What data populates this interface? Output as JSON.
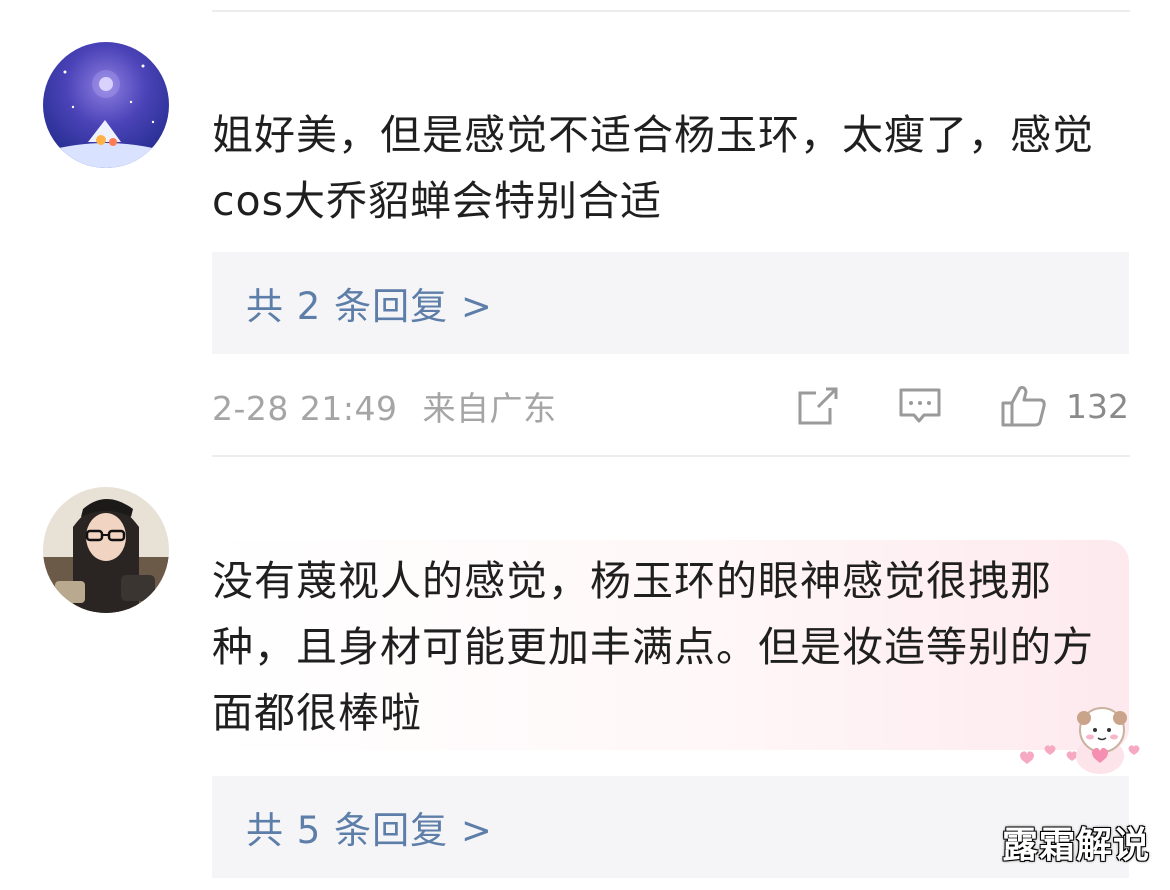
{
  "comments": [
    {
      "text": "姐好美，但是感觉不适合杨玉环，太瘦了，感觉cos大乔貂蝉会特别合适",
      "replies_label": "共 2 条回复 >",
      "time": "2-28 21:49",
      "location": "来自广东",
      "likes": "132"
    },
    {
      "text": "没有蔑视人的感觉，杨玉环的眼神感觉很拽那种，且身材可能更加丰满点。但是妆造等别的方面都很棒啦",
      "replies_label": "共 5 条回复 >"
    }
  ],
  "icons": {
    "share": "share-icon",
    "comment": "comment-icon",
    "like": "thumbs-up-icon"
  },
  "colors": {
    "reply_link": "#5d7ea8",
    "meta_text": "#a5a5a5",
    "reply_box_bg": "#f5f5f7"
  },
  "watermark": "露霜解说"
}
